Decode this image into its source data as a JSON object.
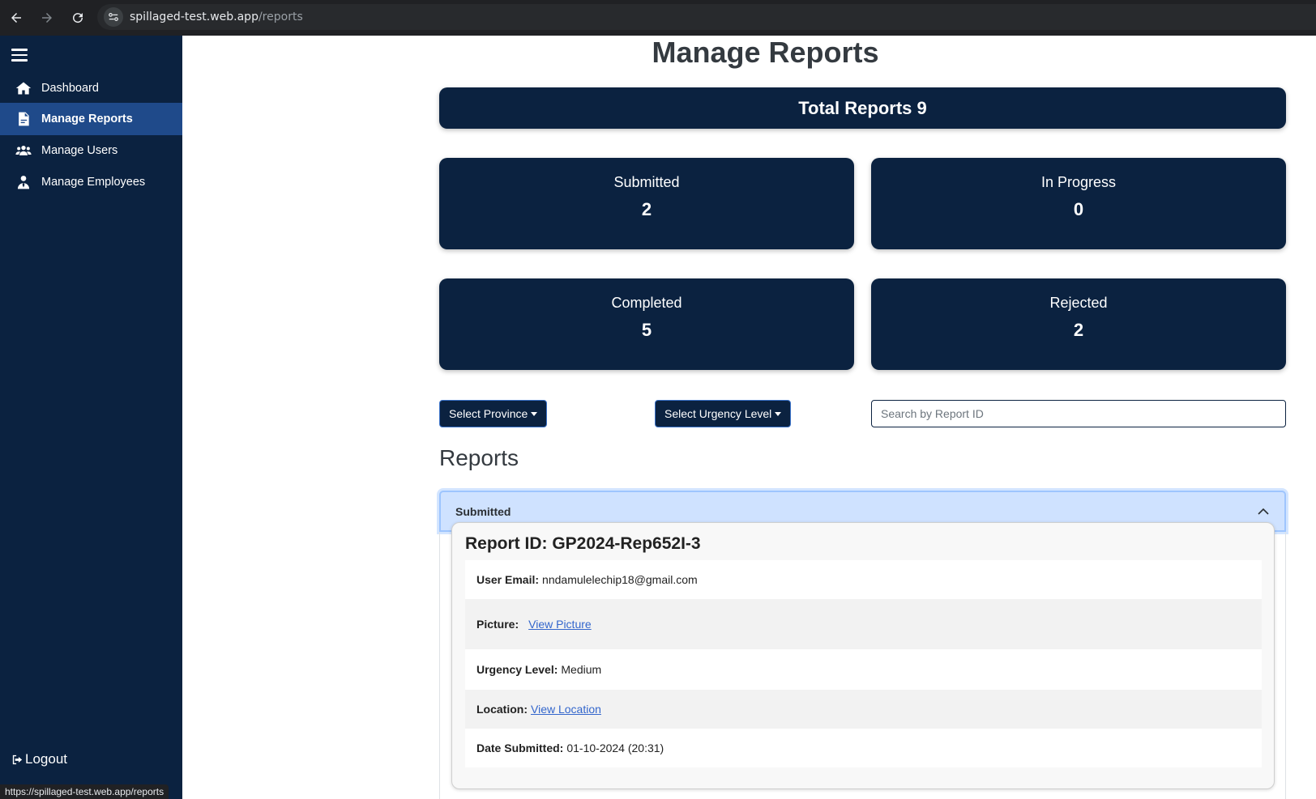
{
  "browser": {
    "url_host": "spillaged-test.web.app",
    "url_path": "/reports",
    "status_url": "https://spillaged-test.web.app/reports",
    "icons": [
      "back-arrow-icon",
      "forward-arrow-icon",
      "reload-icon",
      "site-settings-icon"
    ]
  },
  "sidebar": {
    "items": [
      {
        "label": "Dashboard",
        "icon": "home-icon",
        "active": false
      },
      {
        "label": "Manage Reports",
        "icon": "report-file-icon",
        "active": true
      },
      {
        "label": "Manage Users",
        "icon": "users-icon",
        "active": false
      },
      {
        "label": "Manage Employees",
        "icon": "employee-icon",
        "active": false
      }
    ],
    "logout_label": "Logout"
  },
  "main": {
    "title": "Manage Reports",
    "total_label": "Total Reports 9",
    "stats": [
      {
        "label": "Submitted",
        "value": "2"
      },
      {
        "label": "In Progress",
        "value": "0"
      },
      {
        "label": "Completed",
        "value": "5"
      },
      {
        "label": "Rejected",
        "value": "2"
      }
    ],
    "filters": {
      "province_label": "Select Province",
      "urgency_label": "Select Urgency Level",
      "search_placeholder": "Search by Report ID"
    },
    "section_title": "Reports",
    "accordion": {
      "header": "Submitted",
      "report": {
        "id_label": "Report ID: GP2024-Rep652I-3",
        "email_label": "User Email:",
        "email_value": "nndamulelechip18@gmail.com",
        "picture_label": "Picture:",
        "picture_link": "View Picture",
        "urgency_label": "Urgency Level:",
        "urgency_value": "Medium",
        "location_label": "Location:",
        "location_link": "View Location",
        "date_label": "Date Submitted:",
        "date_value": "01-10-2024 (20:31)"
      }
    }
  },
  "colors": {
    "navy": "#0b2240",
    "active_nav": "#1f4a8a",
    "accordion_bg": "#cfe2ff",
    "link": "#3366cc"
  }
}
